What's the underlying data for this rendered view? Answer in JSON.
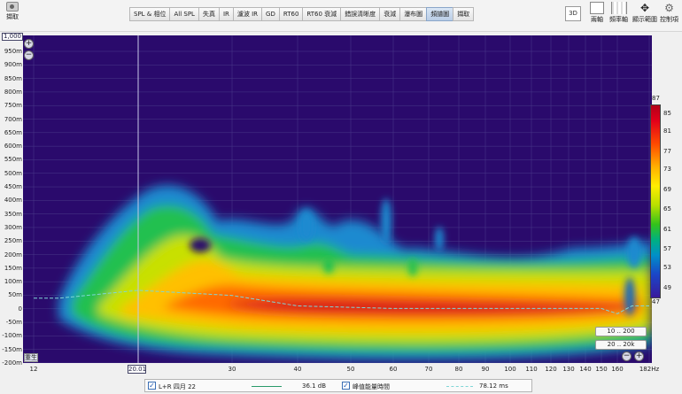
{
  "toolbar": {
    "capture_label": "擷取",
    "tabs": [
      "SPL & 相位",
      "All SPL",
      "失真",
      "IR",
      "濾波 IR",
      "GD",
      "RT60",
      "RT60 衰減",
      "錯誤清晰度",
      "衰減",
      "瀑布圖",
      "頻譜圖",
      "擷取"
    ],
    "active_tab": "頻譜圖",
    "btn_3d": "3D",
    "right_tools": [
      "兩軸",
      "頻率軸",
      "顯示範圍",
      "控制項"
    ]
  },
  "plot": {
    "y_axis_max_value": "1,000",
    "y_tick_labels": [
      "950m",
      "900m",
      "850m",
      "800m",
      "750m",
      "700m",
      "650m",
      "600m",
      "550m",
      "500m",
      "450m",
      "400m",
      "350m",
      "300m",
      "250m",
      "200m",
      "150m",
      "100m",
      "50m",
      "0",
      "-50m",
      "-100m",
      "-150m",
      "-200m"
    ],
    "x_tick_labels": [
      "12",
      "30",
      "40",
      "50",
      "60",
      "70",
      "80",
      "90",
      "100",
      "110",
      "120",
      "130",
      "140",
      "150",
      "160",
      "182Hz"
    ],
    "x_axis_min_value": "20.01",
    "reset_label": "重生",
    "range_buttons": [
      "10 .. 200",
      "20 .. 20k"
    ],
    "colorbar_labels": [
      "87",
      "85",
      "81",
      "77",
      "73",
      "69",
      "65",
      "61",
      "57",
      "53",
      "49",
      "47"
    ]
  },
  "legend": {
    "series_label": "L+R 四月 22",
    "series_value": "36.1 dB",
    "overlay_label": "峰值能量時間",
    "overlay_value": "78.12 ms"
  },
  "colors": {
    "background": "#2a0a6c",
    "peak_energy_line": "#7fd6d6",
    "series_line": "#2a9a6a"
  },
  "chart_data": {
    "type": "heatmap",
    "y_unit": "s",
    "ylim": [
      -0.2,
      1.0
    ],
    "xlim": [
      12,
      182
    ],
    "colorbar_range_db": [
      47,
      87
    ],
    "peak_energy_time_ms": [
      [
        12,
        50
      ],
      [
        14,
        50
      ],
      [
        20,
        80
      ],
      [
        30,
        60
      ],
      [
        40,
        20
      ],
      [
        60,
        10
      ],
      [
        100,
        10
      ],
      [
        150,
        10
      ],
      [
        160,
        -10
      ],
      [
        170,
        20
      ],
      [
        182,
        20
      ]
    ]
  }
}
